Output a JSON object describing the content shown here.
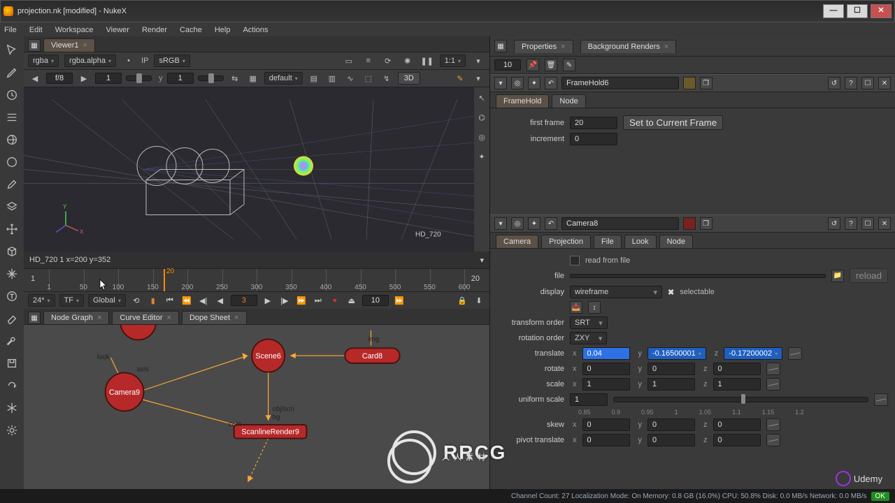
{
  "window": {
    "title": "projection.nk [modified] - NukeX"
  },
  "menus": [
    "File",
    "Edit",
    "Workspace",
    "Viewer",
    "Render",
    "Cache",
    "Help",
    "Actions"
  ],
  "toolstrip_icons": [
    "arrow",
    "pencil",
    "clock",
    "bars",
    "globe",
    "circle",
    "edit",
    "layers",
    "move",
    "cube",
    "spark",
    "type",
    "eraser",
    "wrench",
    "save",
    "reload",
    "snow",
    "gear"
  ],
  "viewer": {
    "tab": "Viewer1",
    "channels": {
      "a": "rgba",
      "b": "rgba.alpha",
      "ip": "IP",
      "colorspace": "sRGB",
      "ratio": "1:1"
    },
    "playbar": {
      "left_arrow": "◀",
      "fstop": "f/8",
      "right_arrow": "▶",
      "gain": "1",
      "ylabel": "y",
      "gamma": "1",
      "preset": "default",
      "mode3d": "3D"
    },
    "info": "HD_720 1 x=200 y=352",
    "overlay_label": "HD_720"
  },
  "timeline": {
    "start": "1",
    "end": "20",
    "play_marker": "20",
    "ticks": [
      1,
      50,
      100,
      150,
      200,
      250,
      300,
      350,
      400,
      450,
      500,
      550,
      600
    ],
    "fps": "24*",
    "tf": "TF",
    "space": "Global",
    "cur": "3",
    "step": "10"
  },
  "bottom_tabs": [
    "Node Graph",
    "Curve Editor",
    "Dope Sheet"
  ],
  "nodes": {
    "camera9": "Camera9",
    "scene6": "Scene6",
    "card8": "Card8",
    "scanline": "ScanlineRender9",
    "ports": {
      "look": "look",
      "axis": "axis",
      "cam": "cam",
      "obj_scn": "obj/scn",
      "bg": "bg",
      "img": "img"
    }
  },
  "properties": {
    "tabA": "Properties",
    "tabB": "Background Renders",
    "countfield": "10",
    "panel1": {
      "node": "FrameHold6",
      "tabs": [
        "FrameHold",
        "Node"
      ],
      "first_frame_label": "first frame",
      "first_frame": "20",
      "set_btn": "Set to Current Frame",
      "increment_label": "increment",
      "increment": "0"
    },
    "panel2": {
      "node": "Camera8",
      "tabs": [
        "Camera",
        "Projection",
        "File",
        "Look",
        "Node"
      ],
      "read_label": "read from file",
      "file_label": "file",
      "reload": "reload",
      "display_label": "display",
      "display": "wireframe",
      "selectable": "selectable",
      "transform_order_label": "transform order",
      "transform_order": "SRT",
      "rotation_order_label": "rotation order",
      "rotation_order": "ZXY",
      "translate_label": "translate",
      "translate": {
        "x": "0.04",
        "y": "-0.16500001",
        "z": "-0.17200002"
      },
      "rotate_label": "rotate",
      "rotate": {
        "x": "0",
        "y": "0",
        "z": "0"
      },
      "scale_label": "scale",
      "scale": {
        "x": "1",
        "y": "1",
        "z": "1"
      },
      "uniform_label": "uniform scale",
      "uniform": "1",
      "skew_label": "skew",
      "skew": {
        "x": "0",
        "y": "0",
        "z": "0"
      },
      "pivot_t_label": "pivot translate",
      "pivot_t": {
        "x": "0",
        "y": "0",
        "z": "0"
      },
      "slider_ticks": [
        "0.85",
        "0.9",
        "0.95",
        "1",
        "1.05",
        "1.1",
        "1.15",
        "1.2"
      ]
    }
  },
  "status": "Channel Count: 27 Localization Mode: On Memory: 0.8 GB (16.0%) CPU: 50.8% Disk: 0.0 MB/s Network: 0.0 MB/s",
  "status_ok": "OK",
  "watermark": {
    "main": "RRCG",
    "sub": "人人素材"
  },
  "udemy": "Udemy"
}
